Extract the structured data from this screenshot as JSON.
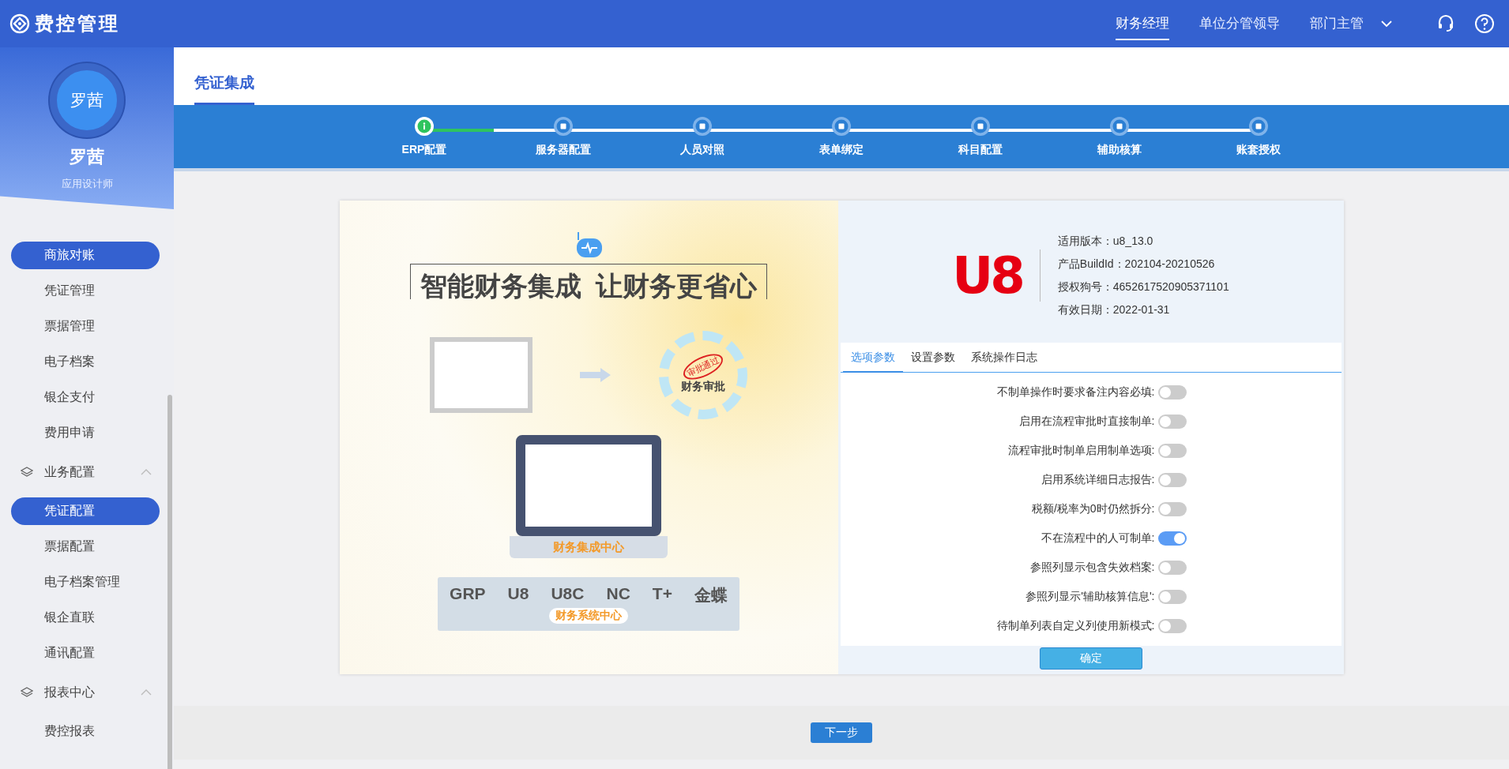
{
  "app": {
    "title": "费控管理"
  },
  "top_nav": [
    {
      "label": "财务经理",
      "selected": true
    },
    {
      "label": "单位分管领导",
      "selected": false
    },
    {
      "label": "部门主管",
      "selected": false
    }
  ],
  "user": {
    "avatar_text": "罗茜",
    "name": "罗茜",
    "role": "应用设计师"
  },
  "sidebar": {
    "items": [
      {
        "kind": "item",
        "label": "商旅对账",
        "selected": true
      },
      {
        "kind": "item",
        "label": "凭证管理",
        "selected": false
      },
      {
        "kind": "item",
        "label": "票据管理",
        "selected": false
      },
      {
        "kind": "item",
        "label": "电子档案",
        "selected": false
      },
      {
        "kind": "item",
        "label": "银企支付",
        "selected": false
      },
      {
        "kind": "item",
        "label": "费用申请",
        "selected": false
      },
      {
        "kind": "group",
        "label": "业务配置",
        "expanded": true
      },
      {
        "kind": "item",
        "label": "凭证配置",
        "selected": true
      },
      {
        "kind": "item",
        "label": "票据配置",
        "selected": false
      },
      {
        "kind": "item",
        "label": "电子档案管理",
        "selected": false
      },
      {
        "kind": "item",
        "label": "银企直联",
        "selected": false
      },
      {
        "kind": "item",
        "label": "通讯配置",
        "selected": false
      },
      {
        "kind": "group",
        "label": "报表中心",
        "expanded": true
      },
      {
        "kind": "item",
        "label": "费控报表",
        "selected": false
      }
    ]
  },
  "page_title": "凭证集成",
  "steps": [
    {
      "label": "ERP配置",
      "active": true
    },
    {
      "label": "服务器配置",
      "active": false
    },
    {
      "label": "人员对照",
      "active": false
    },
    {
      "label": "表单绑定",
      "active": false
    },
    {
      "label": "科目配置",
      "active": false
    },
    {
      "label": "辅助核算",
      "active": false
    },
    {
      "label": "账套授权",
      "active": false
    }
  ],
  "illustration": {
    "title": "智能财务集成  让财务更省心",
    "stamp": "审批通过",
    "approval": "财务审批",
    "center": "财务集成中心",
    "systems": [
      "GRP",
      "U8",
      "U8C",
      "NC",
      "T+",
      "金蝶"
    ],
    "system_center": "财务系统中心"
  },
  "product": {
    "logo": "U8",
    "info": [
      "适用版本：u8_13.0",
      "产品BuildId：202104-20210526",
      "授权狗号：4652617520905371101",
      "有效日期：2022-01-31"
    ]
  },
  "tabs": [
    {
      "label": "选项参数",
      "selected": true
    },
    {
      "label": "设置参数",
      "selected": false
    },
    {
      "label": "系统操作日志",
      "selected": false
    }
  ],
  "options": [
    {
      "label": "不制单操作时要求备注内容必填:",
      "on": false
    },
    {
      "label": "启用在流程审批时直接制单:",
      "on": false
    },
    {
      "label": "流程审批时制单启用制单选项:",
      "on": false
    },
    {
      "label": "启用系统详细日志报告:",
      "on": false
    },
    {
      "label": "税额/税率为0时仍然拆分:",
      "on": false
    },
    {
      "label": "不在流程中的人可制单:",
      "on": true
    },
    {
      "label": "参照列显示包含失效档案:",
      "on": false
    },
    {
      "label": "参照列显示'辅助核算信息':",
      "on": false
    },
    {
      "label": "待制单列表自定义列使用新模式:",
      "on": false
    }
  ],
  "confirm_button": "确定",
  "next_button": "下一步"
}
